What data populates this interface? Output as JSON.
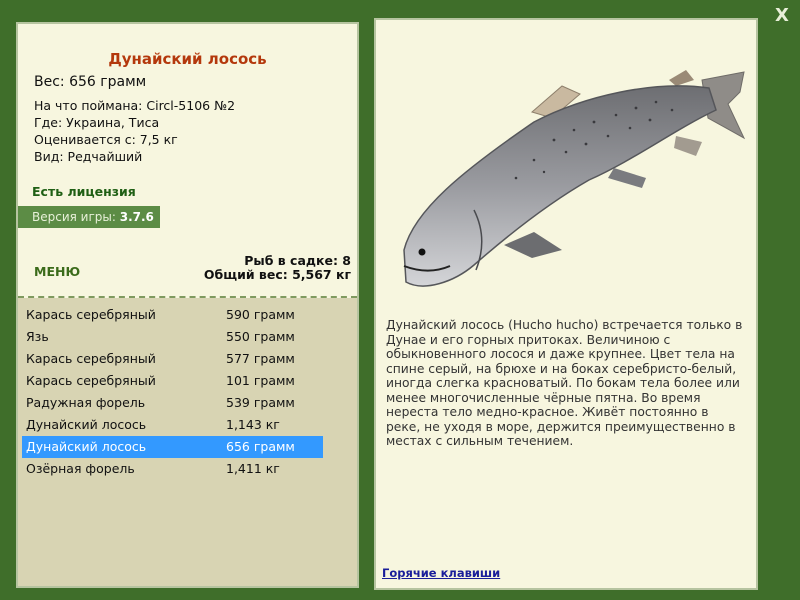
{
  "window": {
    "close_label": "X"
  },
  "fish": {
    "name": "Дунайский лосось",
    "weight": "Вес: 656 грамм",
    "caught_with": "На что поймана: Circl-5106 №2",
    "location": "Где: Украина, Тиса",
    "value": "Оценивается с: 7,5 кг",
    "rarity": "Вид: Редчайший",
    "description": "Дунайский лосось (Hucho hucho) встречается только в Дунае и его горных притоках. Величиною с обыкновенного лосося и даже крупнее. Цвет тела на спине серый, на брюхе и на боках серебристо-белый, иногда слегка красноватый. По бокам тела более или менее многочисленные чёрные пятна. Во время нереста тело медно-красное. Живёт постоянно в реке, не уходя в море, держится преимущественно в местах с сильным течением."
  },
  "license": "Есть лицензия",
  "version": {
    "label": "Версия игры: ",
    "number": "3.7.6"
  },
  "menu_label": "МЕНЮ",
  "keepnet": {
    "count": "Рыб в садке: 8",
    "total": "Общий вес: 5,567 кг"
  },
  "catch_list": [
    {
      "name": "Карась серебряный",
      "weight": "590 грамм"
    },
    {
      "name": "Язь",
      "weight": "550 грамм"
    },
    {
      "name": "Карась серебряный",
      "weight": "577 грамм"
    },
    {
      "name": "Карась серебряный",
      "weight": "101 грамм"
    },
    {
      "name": "Радужная форель",
      "weight": "539 грамм"
    },
    {
      "name": "Дунайский лосось",
      "weight": "1,143 кг"
    },
    {
      "name": "Дунайский лосось",
      "weight": "656 грамм"
    },
    {
      "name": "Озёрная форель",
      "weight": "1,411 кг"
    }
  ],
  "selected_index": 6,
  "hotkeys_label": "Горячие клавиши",
  "colors": {
    "background": "#3f6e2a",
    "panel": "#f7f6df",
    "title": "#b4380c",
    "selection": "#3399ff",
    "link": "#1a1e9a"
  }
}
